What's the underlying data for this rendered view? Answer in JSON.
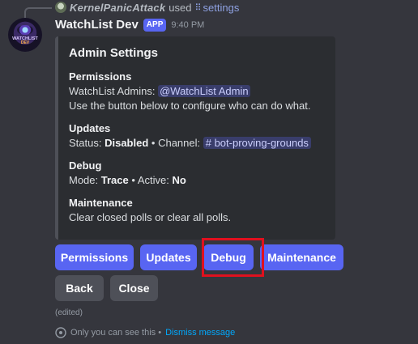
{
  "reply": {
    "username": "KernelPanicAttack",
    "used_text": "used",
    "command": "settings"
  },
  "message": {
    "bot_name": "WatchList Dev",
    "badge": "APP",
    "timestamp": "9:40 PM",
    "avatar_text_1": "WATCHLIST",
    "avatar_text_2": "DEV"
  },
  "embed": {
    "title": "Admin Settings",
    "fields": [
      {
        "name": "Permissions",
        "line1_label": "WatchList Admins:",
        "line1_mention": "@WatchList Admin",
        "line2": "Use the button below to configure who can do what."
      },
      {
        "name": "Updates",
        "status_label": "Status:",
        "status_value": "Disabled",
        "channel_label": "• Channel:",
        "channel_value": "bot-proving-grounds"
      },
      {
        "name": "Debug",
        "mode_label": "Mode:",
        "mode_value": "Trace",
        "active_label": "• Active:",
        "active_value": "No"
      },
      {
        "name": "Maintenance",
        "line1": "Clear closed polls or clear all polls."
      }
    ]
  },
  "buttons": {
    "permissions": "Permissions",
    "updates": "Updates",
    "debug": "Debug",
    "maintenance": "Maintenance",
    "back": "Back",
    "close": "Close"
  },
  "footer": {
    "edited": "(edited)",
    "only_you": "Only you can see this •",
    "dismiss": "Dismiss message"
  },
  "colors": {
    "primary": "#5865f2",
    "secondary": "#4e5058",
    "highlight": "#e0101e",
    "link": "#00a8fc"
  },
  "icons": {
    "command": "slash-command-icon",
    "ephemeral": "eye-icon"
  }
}
